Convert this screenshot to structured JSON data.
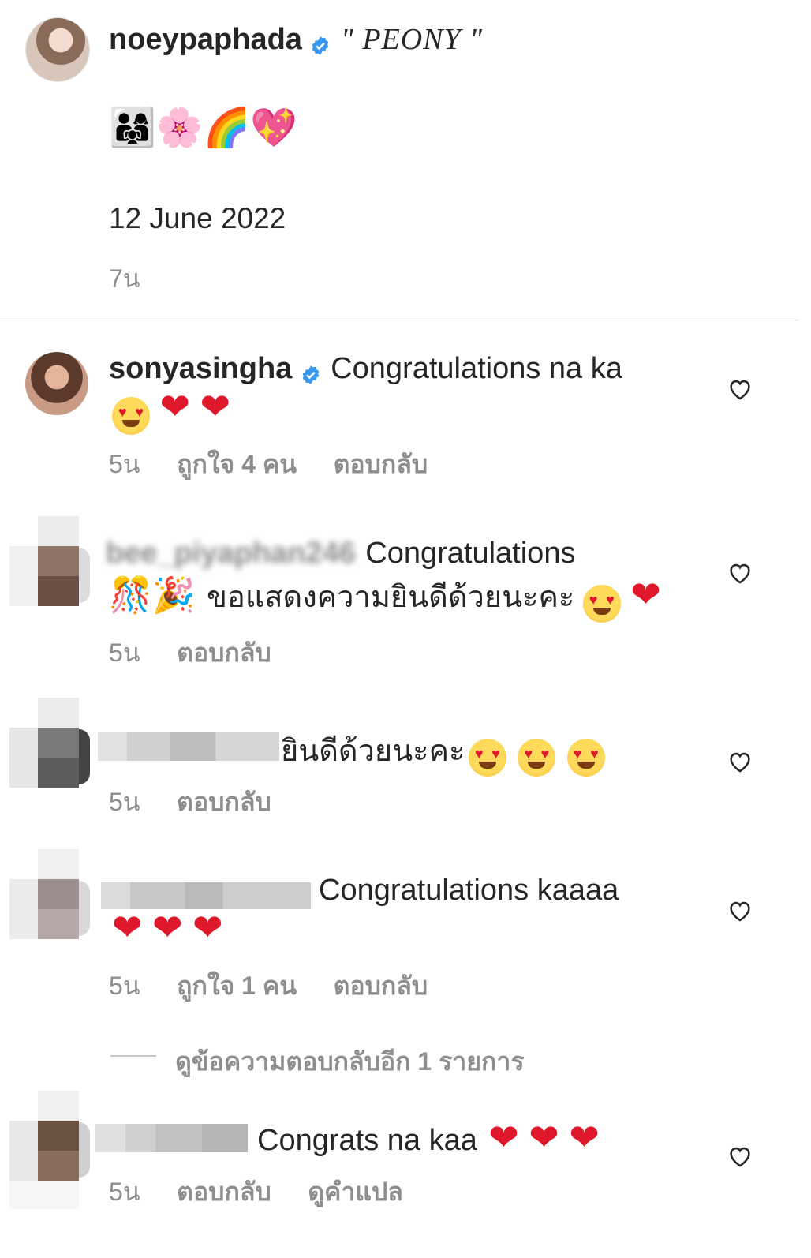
{
  "caption": {
    "username": "noeypaphada",
    "title": "\" PEONY \"",
    "emojis": "👨‍👩‍👧🌸🌈💖",
    "date": "12 June 2022",
    "time": "7น"
  },
  "comments": [
    {
      "username": "sonyasingha",
      "text": "Congratulations na ka",
      "time": "5น",
      "likes": "ถูกใจ 4 คน",
      "reply": "ตอบกลับ"
    },
    {
      "username": "bee_piyaphan246",
      "text": "Congratulations",
      "text2": "ขอแสดงความยินดีด้วยนะคะ",
      "time": "5น",
      "reply": "ตอบกลับ"
    },
    {
      "text": "ยินดีด้วยนะคะ",
      "time": "5น",
      "reply": "ตอบกลับ"
    },
    {
      "text": "Congratulations kaaaa",
      "time": "5น",
      "likes": "ถูกใจ 1 คน",
      "reply": "ตอบกลับ"
    },
    {
      "text": "Congrats na kaa",
      "time": "5น",
      "reply": "ตอบกลับ",
      "translate": "ดูคำแปล"
    }
  ],
  "view_replies": "ดูข้อความตอบกลับอีก 1 รายการ",
  "colors": {
    "text": "#262626",
    "meta": "#8e8e8e",
    "verified": "#3897f0",
    "heart": "#e0182b"
  },
  "icons": [
    "verified-badge-icon",
    "heart-outline-icon",
    "heart-emoji",
    "heart-eyes-emoji"
  ]
}
